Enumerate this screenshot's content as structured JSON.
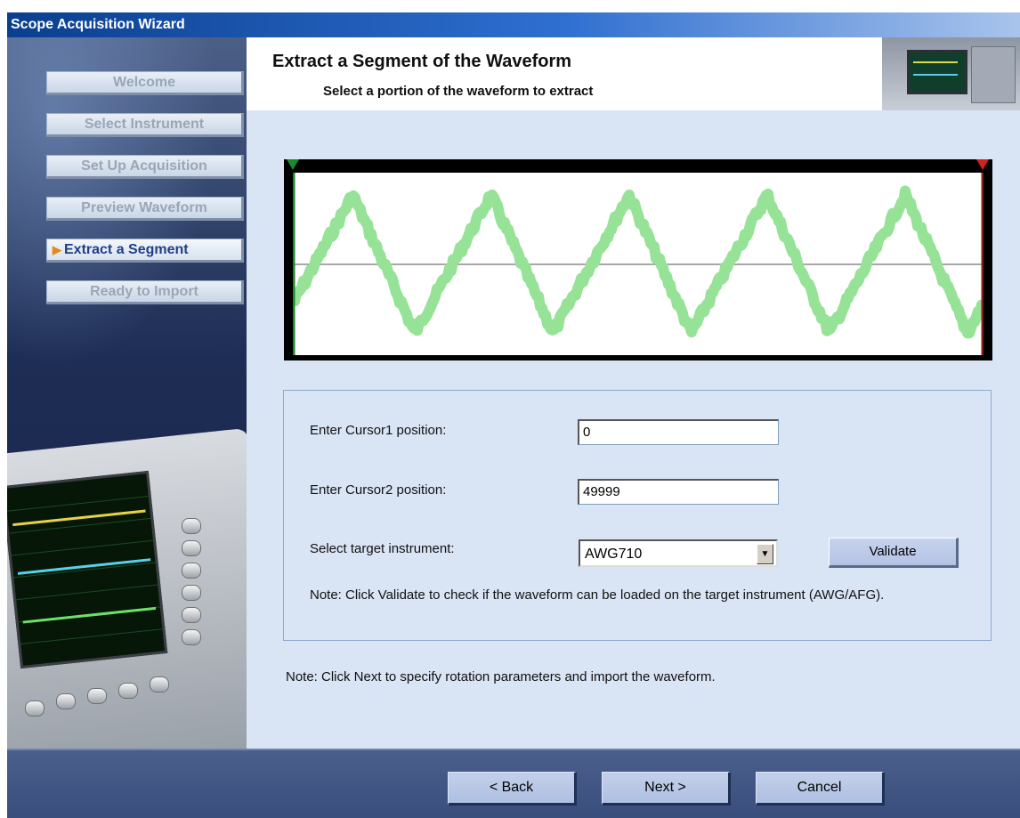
{
  "window": {
    "title": "Scope Acquisition Wizard"
  },
  "nav": {
    "items": [
      {
        "label": "Welcome"
      },
      {
        "label": "Select Instrument"
      },
      {
        "label": "Set Up Acquisition"
      },
      {
        "label": "Preview Waveform"
      },
      {
        "label": "Extract a Segment",
        "active": true
      },
      {
        "label": "Ready to Import"
      }
    ]
  },
  "header": {
    "title": "Extract a Segment of the Waveform",
    "subtitle": "Select a portion of the waveform to extract"
  },
  "waveform": {
    "cursor1_color": "#1a8a2a",
    "cursor2_color": "#d42020",
    "trace_color": "#96e296"
  },
  "form": {
    "cursor1_label": "Enter Cursor1 position:",
    "cursor1_value": "0",
    "cursor2_label": "Enter Cursor2 position:",
    "cursor2_value": "49999",
    "target_label": "Select target instrument:",
    "target_value": "AWG710",
    "validate_label": "Validate",
    "validate_note": "Note: Click Validate to check if the waveform can be loaded on the target instrument (AWG/AFG)."
  },
  "footer_note": "Note: Click Next to specify rotation parameters and import the waveform.",
  "buttons": {
    "back": "< Back",
    "next": "Next >",
    "cancel": "Cancel"
  }
}
